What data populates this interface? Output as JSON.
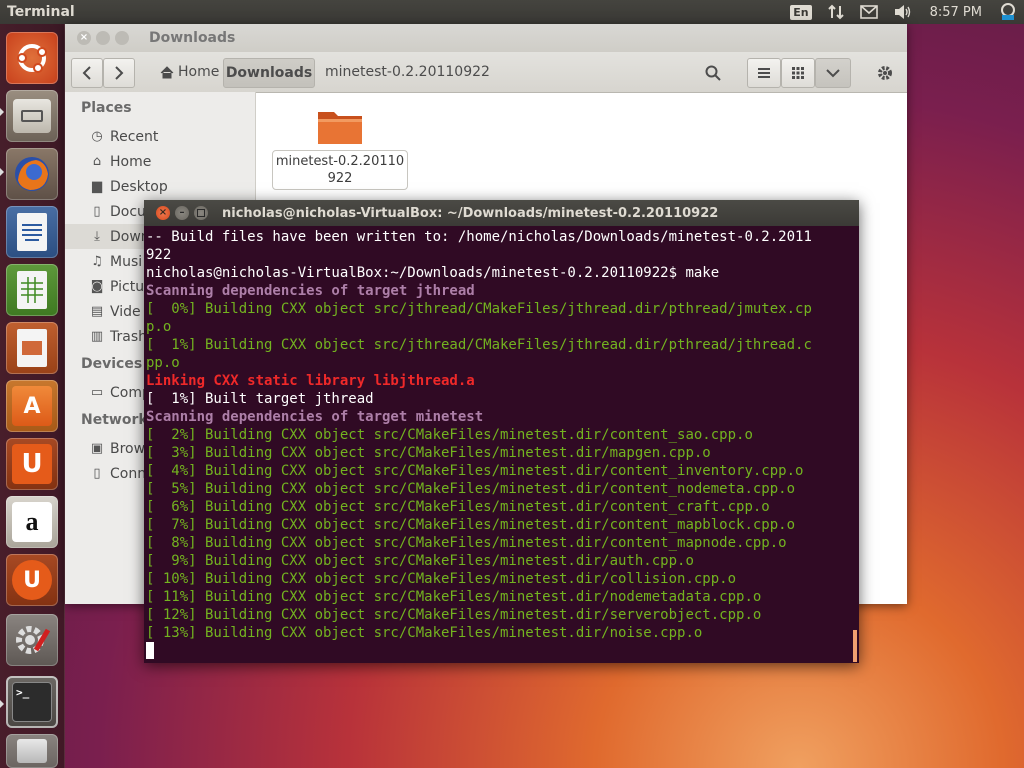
{
  "top_panel": {
    "app_title": "Terminal",
    "keyboard_layout": "En",
    "clock": "8:57 PM"
  },
  "launcher": {
    "items": [
      {
        "name": "ubuntu-dash-icon"
      },
      {
        "name": "files-icon"
      },
      {
        "name": "firefox-icon"
      },
      {
        "name": "libreoffice-writer-icon"
      },
      {
        "name": "libreoffice-calc-icon"
      },
      {
        "name": "libreoffice-impress-icon"
      },
      {
        "name": "ubuntu-software-center-icon"
      },
      {
        "name": "ubuntu-one-icon"
      },
      {
        "name": "amazon-icon"
      },
      {
        "name": "ubuntu-one-music-icon"
      },
      {
        "name": "system-settings-icon"
      },
      {
        "name": "terminal-icon"
      },
      {
        "name": "trash-icon"
      }
    ]
  },
  "file_manager": {
    "title": "Downloads",
    "breadcrumbs": [
      "Home",
      "Downloads",
      "minetest-0.2.20110922"
    ],
    "sidebar": {
      "places_header": "Places",
      "places": [
        "Recent",
        "Home",
        "Desktop",
        "Docu",
        "Down",
        "Musi",
        "Pictu",
        "Vide",
        "Trash"
      ],
      "devices_header": "Devices",
      "devices": [
        "Comp"
      ],
      "network_header": "Network",
      "network": [
        "Brow",
        "Conn"
      ]
    },
    "files": [
      {
        "name": "minetest-0.2.20110922"
      }
    ]
  },
  "terminal": {
    "title": "nicholas@nicholas-VirtualBox: ~/Downloads/minetest-0.2.20110922",
    "lines": [
      {
        "text": "-- Build files have been written to: /home/nicholas/Downloads/minetest-0.2.2011",
        "style": "plain"
      },
      {
        "text": "922",
        "style": "plain"
      },
      {
        "text": "nicholas@nicholas-VirtualBox:~/Downloads/minetest-0.2.20110922$ make",
        "style": "plain"
      },
      {
        "text": "Scanning dependencies of target jthread",
        "style": "purple"
      },
      {
        "text": "[  0%] Building CXX object src/jthread/CMakeFiles/jthread.dir/pthread/jmutex.cp",
        "style": "green"
      },
      {
        "text": "p.o",
        "style": "green"
      },
      {
        "text": "[  1%] Building CXX object src/jthread/CMakeFiles/jthread.dir/pthread/jthread.c",
        "style": "green"
      },
      {
        "text": "pp.o",
        "style": "green"
      },
      {
        "text": "Linking CXX static library libjthread.a",
        "style": "red"
      },
      {
        "text": "[  1%] Built target jthread",
        "style": "plain"
      },
      {
        "text": "Scanning dependencies of target minetest",
        "style": "purple"
      },
      {
        "text": "[  2%] Building CXX object src/CMakeFiles/minetest.dir/content_sao.cpp.o",
        "style": "green"
      },
      {
        "text": "[  3%] Building CXX object src/CMakeFiles/minetest.dir/mapgen.cpp.o",
        "style": "green"
      },
      {
        "text": "[  4%] Building CXX object src/CMakeFiles/minetest.dir/content_inventory.cpp.o",
        "style": "green"
      },
      {
        "text": "[  5%] Building CXX object src/CMakeFiles/minetest.dir/content_nodemeta.cpp.o",
        "style": "green"
      },
      {
        "text": "[  6%] Building CXX object src/CMakeFiles/minetest.dir/content_craft.cpp.o",
        "style": "green"
      },
      {
        "text": "[  7%] Building CXX object src/CMakeFiles/minetest.dir/content_mapblock.cpp.o",
        "style": "green"
      },
      {
        "text": "[  8%] Building CXX object src/CMakeFiles/minetest.dir/content_mapnode.cpp.o",
        "style": "green"
      },
      {
        "text": "[  9%] Building CXX object src/CMakeFiles/minetest.dir/auth.cpp.o",
        "style": "green"
      },
      {
        "text": "[ 10%] Building CXX object src/CMakeFiles/minetest.dir/collision.cpp.o",
        "style": "green"
      },
      {
        "text": "[ 11%] Building CXX object src/CMakeFiles/minetest.dir/nodemetadata.cpp.o",
        "style": "green"
      },
      {
        "text": "[ 12%] Building CXX object src/CMakeFiles/minetest.dir/serverobject.cpp.o",
        "style": "green"
      },
      {
        "text": "[ 13%] Building CXX object src/CMakeFiles/minetest.dir/noise.cpp.o",
        "style": "green"
      }
    ]
  },
  "colors": {
    "terminal_bg": "#300a24",
    "green": "#8ae234",
    "purple": "#ad7fa8",
    "red": "#ef2929",
    "ubuntu_orange": "#dd4814"
  }
}
